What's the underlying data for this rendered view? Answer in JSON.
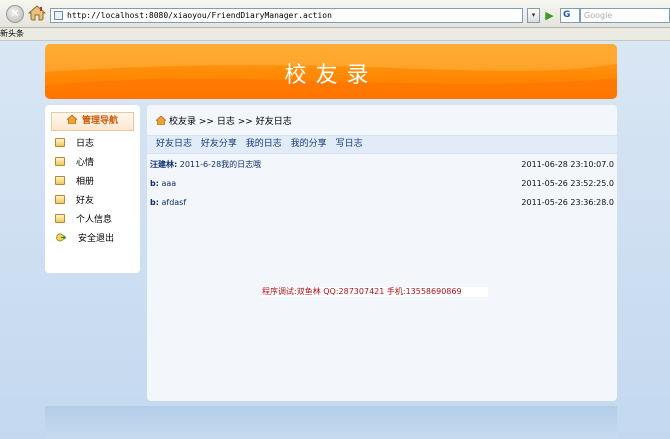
{
  "browser": {
    "address_url": "http://localhost:8080/xiaoyou/FriendDiaryManager.action",
    "search_placeholder": "Google",
    "search_engine_label": "G",
    "dropdown_glyph": "▾",
    "go_glyph": "▶",
    "stop_glyph": "✕",
    "bookmarks_label": "新头条"
  },
  "banner": {
    "title": "校友录"
  },
  "sidebar": {
    "header": "管理导航",
    "items": [
      {
        "label": "日志",
        "icon": "folder-icon"
      },
      {
        "label": "心情",
        "icon": "folder-icon"
      },
      {
        "label": "相册",
        "icon": "folder-icon"
      },
      {
        "label": "好友",
        "icon": "folder-icon"
      },
      {
        "label": "个人信息",
        "icon": "folder-icon"
      },
      {
        "label": "安全退出",
        "icon": "exit-icon"
      }
    ]
  },
  "breadcrumb": {
    "home": "校友录",
    "sep": ">>",
    "level1": "日志",
    "level2": "好友日志"
  },
  "subnav": [
    "好友日志",
    "好友分享",
    "我的日志",
    "我的分享",
    "写日志"
  ],
  "diaries": [
    {
      "author": "汪建林:",
      "title": "2011-6-28我的日志哦",
      "date": "2011-06-28 23:10:07.0"
    },
    {
      "author": "b:",
      "title": "aaa",
      "date": "2011-05-26 23:52:25.0"
    },
    {
      "author": "b:",
      "title": "afdasf",
      "date": "2011-05-26 23:36:28.0"
    }
  ],
  "footer": {
    "credit": "程序调试:双鱼林 QQ:287307421 手机:13558690869"
  },
  "colors": {
    "banner": "#ff8a05",
    "link": "#123a7a",
    "credit": "#b0131a",
    "sidebar_header": "#c85a0a"
  }
}
